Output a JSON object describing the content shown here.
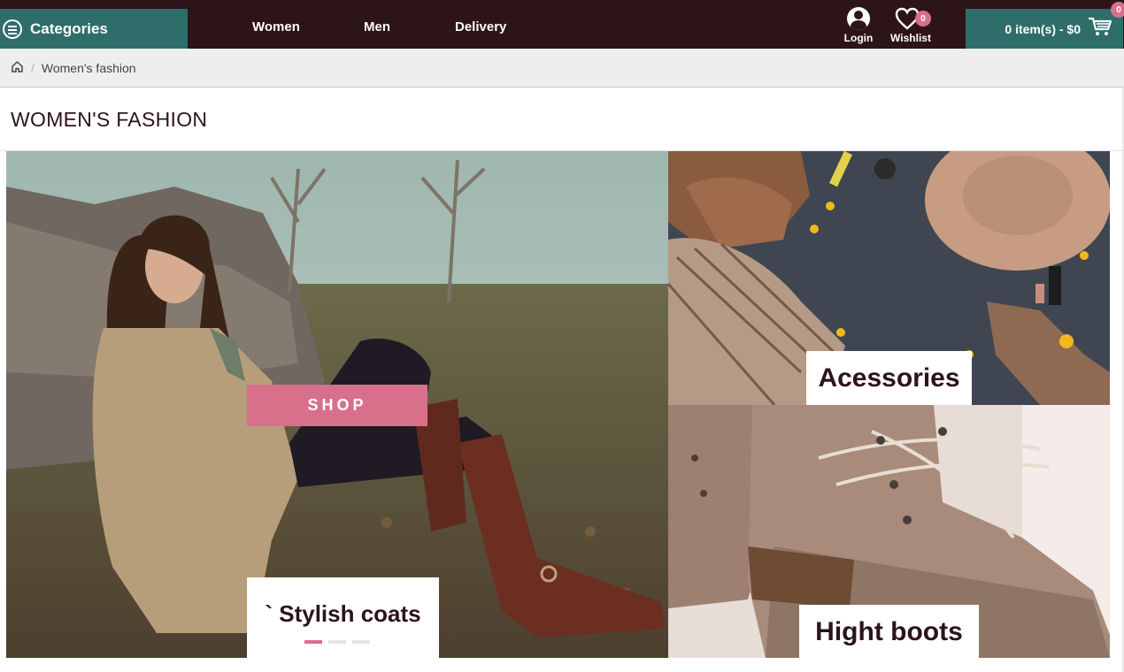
{
  "header": {
    "categories_label": "Categories",
    "nav": [
      "Women",
      "Men",
      "Delivery"
    ],
    "login_label": "Login",
    "wishlist_label": "Wishlist",
    "wishlist_count": "0",
    "cart_label": "0 item(s) - $0",
    "cart_count": "0"
  },
  "breadcrumb": {
    "current": "Women's fashion"
  },
  "page": {
    "title": "WOMEN'S FASHION"
  },
  "banners": {
    "main": {
      "button": "SHOP",
      "caption": "` Stylish coats"
    },
    "accessories": {
      "caption": "Acessories"
    },
    "boots": {
      "caption": "Hight boots"
    }
  },
  "colors": {
    "topbar": "#2d1418",
    "accent_teal": "#2f6d6b",
    "accent_pink": "#d9708b"
  }
}
